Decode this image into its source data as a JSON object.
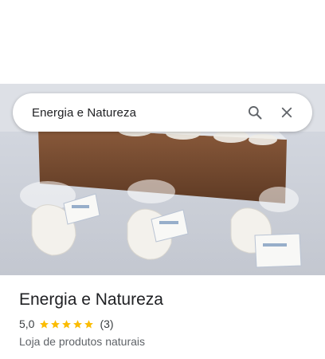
{
  "search": {
    "query": "Energia e Natureza",
    "search_icon": "search-icon",
    "close_icon": "close-icon"
  },
  "place": {
    "name": "Energia e Natureza",
    "rating": "5,0",
    "rating_value": 5,
    "stars_max": 5,
    "review_count": "(3)",
    "category": "Loja de produtos naturais",
    "star_color": "#fbbc04"
  },
  "photo": {
    "description_icon": "place-photo"
  }
}
